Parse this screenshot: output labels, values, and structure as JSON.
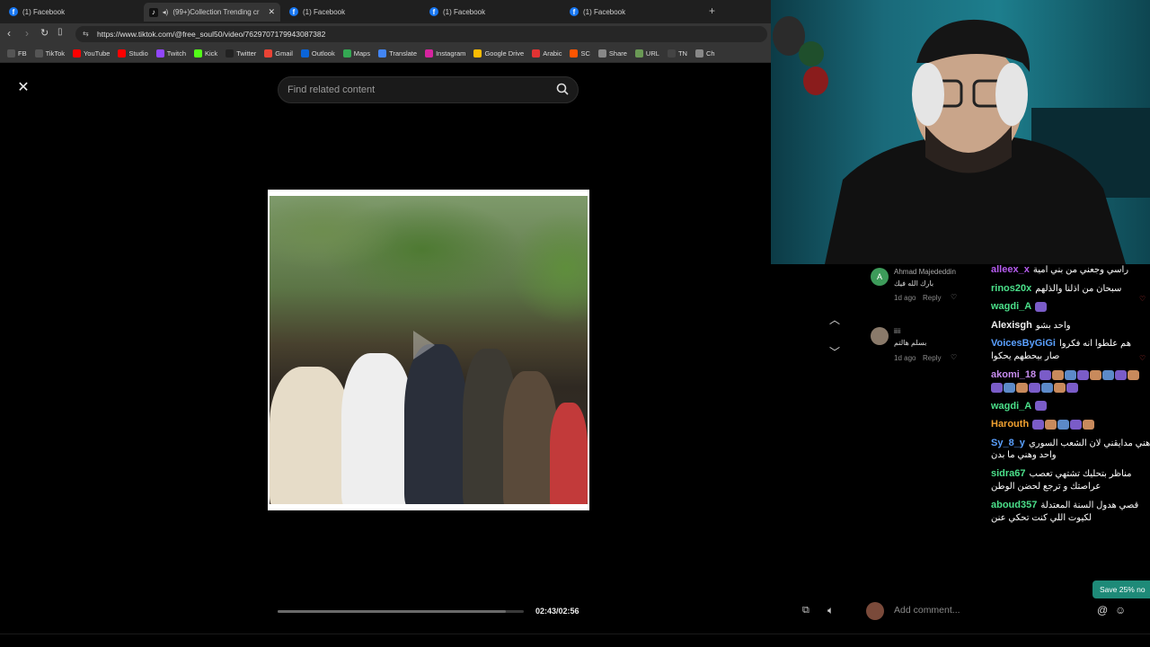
{
  "browser": {
    "tabs": [
      {
        "label": "(1) Facebook",
        "icon": "facebook-icon"
      },
      {
        "label": "(99+)Collection Trending cre",
        "icon": "tiktok-icon",
        "active": true
      },
      {
        "label": "(1) Facebook",
        "icon": "facebook-icon"
      },
      {
        "label": "(1) Facebook",
        "icon": "facebook-icon"
      },
      {
        "label": "(1) Facebook",
        "icon": "facebook-icon"
      }
    ],
    "new_tab": "+",
    "url": "https://www.tiktok.com/@free_soul50/video/7629707179943087382",
    "bookmarks": [
      {
        "label": "FB",
        "color": "#555555"
      },
      {
        "label": "TikTok",
        "color": "#555555"
      },
      {
        "label": "YouTube",
        "color": "#ff0000"
      },
      {
        "label": "Studio",
        "color": "#ff0000"
      },
      {
        "label": "Twitch",
        "color": "#9146ff"
      },
      {
        "label": "Kick",
        "color": "#53fc18"
      },
      {
        "label": "Twitter",
        "color": "#222222"
      },
      {
        "label": "Gmail",
        "color": "#ea4335"
      },
      {
        "label": "Outlook",
        "color": "#0a64d8"
      },
      {
        "label": "Maps",
        "color": "#34a853"
      },
      {
        "label": "Translate",
        "color": "#4285f4"
      },
      {
        "label": "Instagram",
        "color": "#d6249f"
      },
      {
        "label": "Google Drive",
        "color": "#fbbc04"
      },
      {
        "label": "Arabic",
        "color": "#e33333"
      },
      {
        "label": "SC",
        "color": "#ff5500"
      },
      {
        "label": "Share",
        "color": "#888888"
      },
      {
        "label": "URL",
        "color": "#6a9955"
      },
      {
        "label": "TN",
        "color": "#444444"
      },
      {
        "label": "Ch",
        "color": "#888888"
      }
    ]
  },
  "viewer": {
    "search_placeholder": "Find related content",
    "time": "02:43/02:56",
    "progress": 0.926
  },
  "comments": [
    {
      "author": "Ahmad Majededdin",
      "avatar_letter": "A",
      "avatar_color": "#3d9b5a",
      "text": "بارك الله فيك",
      "age": "1d ago",
      "reply": "Reply"
    },
    {
      "author": "iiii",
      "avatar_letter": "",
      "avatar_color": "#8a7a6a",
      "text": "بسلم هالتم",
      "age": "1d ago",
      "reply": "Reply"
    }
  ],
  "chat": [
    {
      "user": "alleex_x",
      "color": "#b65cf0",
      "msg": "راسي وجعني من بني امية"
    },
    {
      "user": "rinos20x",
      "color": "#4be08a",
      "msg": "سبحان من اذلنا والذلهم"
    },
    {
      "user": "wagdi_A",
      "color": "#4be08a",
      "msg": "",
      "emotes": 1
    },
    {
      "user": "Alexisgh",
      "color": "#f0f0f0",
      "msg": "واحد بشو"
    },
    {
      "user": "VoicesByGiGi",
      "color": "#5aa0ff",
      "msg": "هم علطوا انه فكروا",
      "cont": "صار بيحطهم يحكوا"
    },
    {
      "user": "akomi_18",
      "color": "#c78cf0",
      "msg": "",
      "emotes": 8,
      "emotes2": 7
    },
    {
      "user": "wagdi_A",
      "color": "#4be08a",
      "msg": "",
      "emotes": 1
    },
    {
      "user": "Harouth",
      "color": "#f0a030",
      "msg": "",
      "emotes": 5
    },
    {
      "user": "Sy_8_y",
      "color": "#5aa0ff",
      "msg": "هني مدايقني لان الشعب السوري",
      "cont": "واحد وهني ما بدن"
    },
    {
      "user": "sidra67",
      "color": "#4be08a",
      "msg": "مناظر بتحليك تشتهي تعصب",
      "cont": "عراصتك و ترجع لحضن الوطن"
    },
    {
      "user": "aboud357",
      "color": "#4be08a",
      "msg": "قصي هدول السنة المعتدلة",
      "cont": "لكيوت اللي كنت تحكي عنن"
    }
  ],
  "save_badge": "Save 25% no",
  "add_comment_placeholder": "Add comment..."
}
